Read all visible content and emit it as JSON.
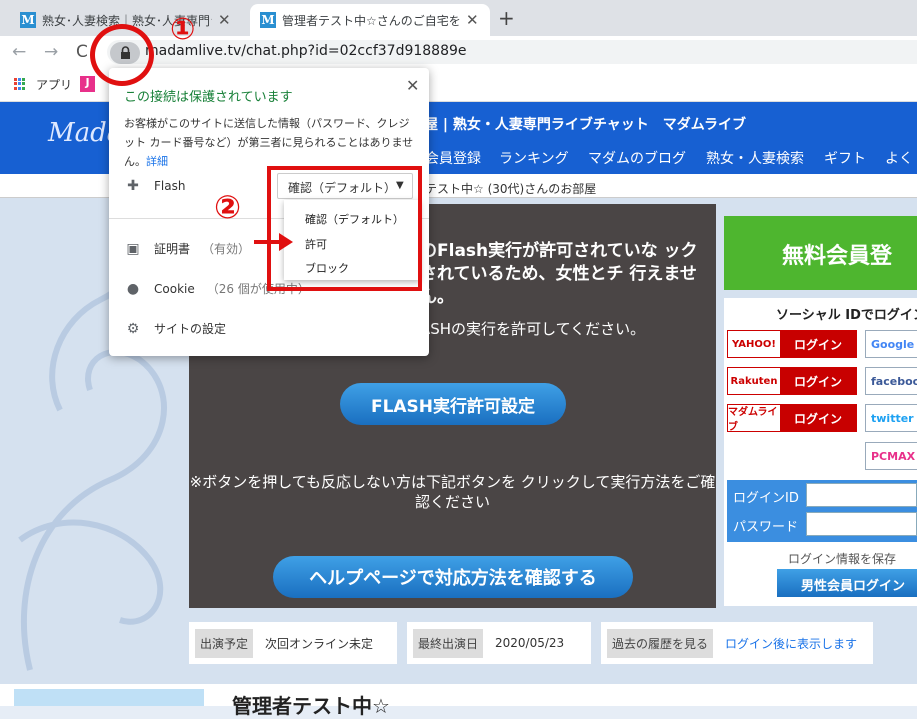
{
  "browser": {
    "tabs": [
      {
        "title": "熟女･人妻検索｜熟女･人妻専門ラ",
        "favicon": "M"
      },
      {
        "title": "管理者テスト中☆さんのご自宅を生中継",
        "favicon": "M"
      }
    ],
    "url": "madamlive.tv/chat.php?id=02ccf37d918889e",
    "bookmarks_label": "アプリ"
  },
  "site": {
    "logo": "Madam Live",
    "title": "屋 | 熟女・人妻専門ライブチャット　マダムライブ",
    "nav": [
      "会員登録",
      "ランキング",
      "マダムのブログ",
      "熟女・人妻検索",
      "ギフト",
      "よく"
    ],
    "breadcrumb": "テスト中☆ (30代)さんのお部屋",
    "player": {
      "message": "のFlash実行が許可されていな ックされているため、女性とチ 行えません。",
      "message2": "ASHの実行を許可してください。",
      "flash_button": "FLASH実行許可設定",
      "note": "※ボタンを押しても反応しない方は下記ボタンを クリックして実行方法をご確認ください",
      "help_button": "ヘルプページで対応方法を確認する"
    },
    "register_button": "無料会員登",
    "social": {
      "title": "ソーシャル IDでログイン",
      "login_label": "ログイン",
      "left": [
        "YAHOO!",
        "Rakuten",
        "マダムライブ"
      ],
      "right": [
        "Google",
        "facebook",
        "twitter",
        "PCMAX"
      ]
    },
    "login": {
      "id_label": "ログインID",
      "password_label": "パスワード",
      "save_text": "ログイン情報を保存",
      "male_button": "男性会員ログイン"
    },
    "info": [
      {
        "key": "出演予定",
        "value": "次回オンライン未定"
      },
      {
        "key": "最終出演日",
        "value": "2020/05/23"
      },
      {
        "key": "過去の履歴を見る",
        "value": "ログイン後に表示します"
      }
    ],
    "bottom_name": "管理者テスト中☆"
  },
  "popup": {
    "title": "この接続は保護されています",
    "description": "お客様がこのサイトに送信した情報（パスワード、クレジット カード番号など）が第三者に見られることはありません。",
    "details_link": "詳細",
    "flash_label": "Flash",
    "flash_value": "確認（デフォルト）",
    "options": [
      "確認（デフォルト）",
      "許可",
      "ブロック"
    ],
    "cert_label": "証明書",
    "cert_sub": "（有効）",
    "cookie_label": "Cookie",
    "cookie_sub": "（26 個が使用中）",
    "settings_label": "サイトの設定"
  },
  "annotations": {
    "step1": "①",
    "step2": "②"
  }
}
